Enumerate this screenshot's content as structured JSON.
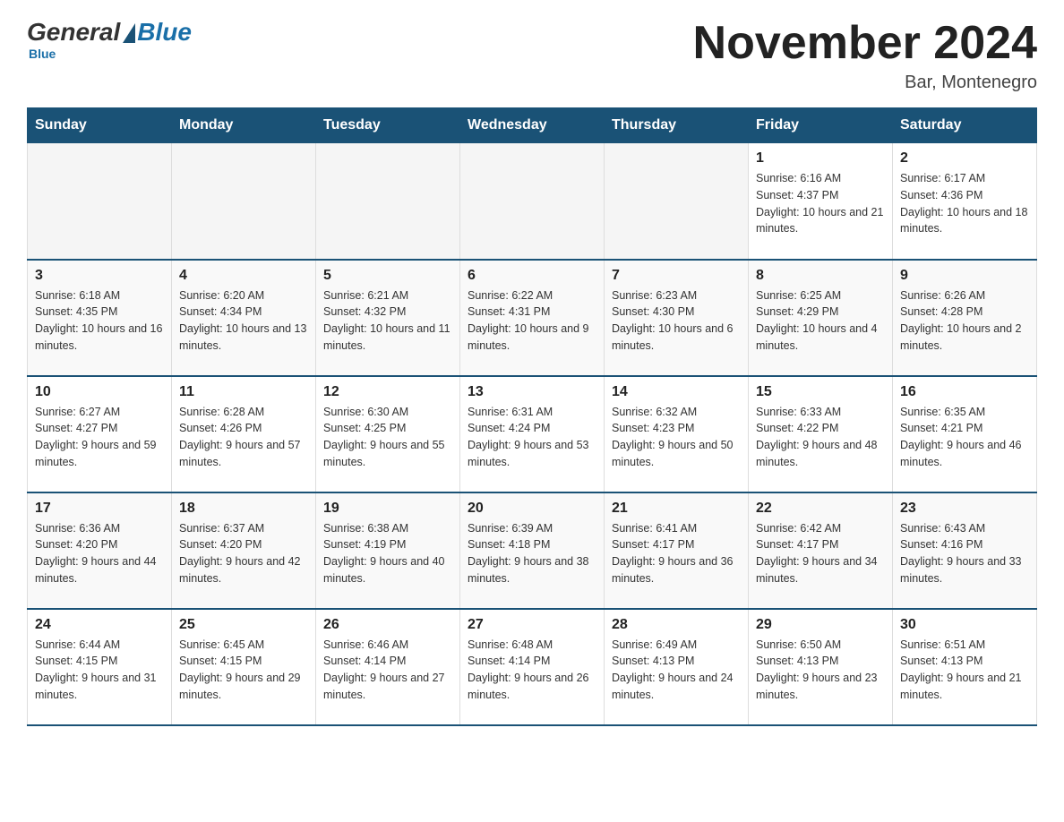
{
  "logo": {
    "general": "General",
    "blue": "Blue",
    "tagline": "Blue"
  },
  "title": "November 2024",
  "location": "Bar, Montenegro",
  "days_of_week": [
    "Sunday",
    "Monday",
    "Tuesday",
    "Wednesday",
    "Thursday",
    "Friday",
    "Saturday"
  ],
  "weeks": [
    [
      {
        "day": "",
        "sunrise": "",
        "sunset": "",
        "daylight": ""
      },
      {
        "day": "",
        "sunrise": "",
        "sunset": "",
        "daylight": ""
      },
      {
        "day": "",
        "sunrise": "",
        "sunset": "",
        "daylight": ""
      },
      {
        "day": "",
        "sunrise": "",
        "sunset": "",
        "daylight": ""
      },
      {
        "day": "",
        "sunrise": "",
        "sunset": "",
        "daylight": ""
      },
      {
        "day": "1",
        "sunrise": "Sunrise: 6:16 AM",
        "sunset": "Sunset: 4:37 PM",
        "daylight": "Daylight: 10 hours and 21 minutes."
      },
      {
        "day": "2",
        "sunrise": "Sunrise: 6:17 AM",
        "sunset": "Sunset: 4:36 PM",
        "daylight": "Daylight: 10 hours and 18 minutes."
      }
    ],
    [
      {
        "day": "3",
        "sunrise": "Sunrise: 6:18 AM",
        "sunset": "Sunset: 4:35 PM",
        "daylight": "Daylight: 10 hours and 16 minutes."
      },
      {
        "day": "4",
        "sunrise": "Sunrise: 6:20 AM",
        "sunset": "Sunset: 4:34 PM",
        "daylight": "Daylight: 10 hours and 13 minutes."
      },
      {
        "day": "5",
        "sunrise": "Sunrise: 6:21 AM",
        "sunset": "Sunset: 4:32 PM",
        "daylight": "Daylight: 10 hours and 11 minutes."
      },
      {
        "day": "6",
        "sunrise": "Sunrise: 6:22 AM",
        "sunset": "Sunset: 4:31 PM",
        "daylight": "Daylight: 10 hours and 9 minutes."
      },
      {
        "day": "7",
        "sunrise": "Sunrise: 6:23 AM",
        "sunset": "Sunset: 4:30 PM",
        "daylight": "Daylight: 10 hours and 6 minutes."
      },
      {
        "day": "8",
        "sunrise": "Sunrise: 6:25 AM",
        "sunset": "Sunset: 4:29 PM",
        "daylight": "Daylight: 10 hours and 4 minutes."
      },
      {
        "day": "9",
        "sunrise": "Sunrise: 6:26 AM",
        "sunset": "Sunset: 4:28 PM",
        "daylight": "Daylight: 10 hours and 2 minutes."
      }
    ],
    [
      {
        "day": "10",
        "sunrise": "Sunrise: 6:27 AM",
        "sunset": "Sunset: 4:27 PM",
        "daylight": "Daylight: 9 hours and 59 minutes."
      },
      {
        "day": "11",
        "sunrise": "Sunrise: 6:28 AM",
        "sunset": "Sunset: 4:26 PM",
        "daylight": "Daylight: 9 hours and 57 minutes."
      },
      {
        "day": "12",
        "sunrise": "Sunrise: 6:30 AM",
        "sunset": "Sunset: 4:25 PM",
        "daylight": "Daylight: 9 hours and 55 minutes."
      },
      {
        "day": "13",
        "sunrise": "Sunrise: 6:31 AM",
        "sunset": "Sunset: 4:24 PM",
        "daylight": "Daylight: 9 hours and 53 minutes."
      },
      {
        "day": "14",
        "sunrise": "Sunrise: 6:32 AM",
        "sunset": "Sunset: 4:23 PM",
        "daylight": "Daylight: 9 hours and 50 minutes."
      },
      {
        "day": "15",
        "sunrise": "Sunrise: 6:33 AM",
        "sunset": "Sunset: 4:22 PM",
        "daylight": "Daylight: 9 hours and 48 minutes."
      },
      {
        "day": "16",
        "sunrise": "Sunrise: 6:35 AM",
        "sunset": "Sunset: 4:21 PM",
        "daylight": "Daylight: 9 hours and 46 minutes."
      }
    ],
    [
      {
        "day": "17",
        "sunrise": "Sunrise: 6:36 AM",
        "sunset": "Sunset: 4:20 PM",
        "daylight": "Daylight: 9 hours and 44 minutes."
      },
      {
        "day": "18",
        "sunrise": "Sunrise: 6:37 AM",
        "sunset": "Sunset: 4:20 PM",
        "daylight": "Daylight: 9 hours and 42 minutes."
      },
      {
        "day": "19",
        "sunrise": "Sunrise: 6:38 AM",
        "sunset": "Sunset: 4:19 PM",
        "daylight": "Daylight: 9 hours and 40 minutes."
      },
      {
        "day": "20",
        "sunrise": "Sunrise: 6:39 AM",
        "sunset": "Sunset: 4:18 PM",
        "daylight": "Daylight: 9 hours and 38 minutes."
      },
      {
        "day": "21",
        "sunrise": "Sunrise: 6:41 AM",
        "sunset": "Sunset: 4:17 PM",
        "daylight": "Daylight: 9 hours and 36 minutes."
      },
      {
        "day": "22",
        "sunrise": "Sunrise: 6:42 AM",
        "sunset": "Sunset: 4:17 PM",
        "daylight": "Daylight: 9 hours and 34 minutes."
      },
      {
        "day": "23",
        "sunrise": "Sunrise: 6:43 AM",
        "sunset": "Sunset: 4:16 PM",
        "daylight": "Daylight: 9 hours and 33 minutes."
      }
    ],
    [
      {
        "day": "24",
        "sunrise": "Sunrise: 6:44 AM",
        "sunset": "Sunset: 4:15 PM",
        "daylight": "Daylight: 9 hours and 31 minutes."
      },
      {
        "day": "25",
        "sunrise": "Sunrise: 6:45 AM",
        "sunset": "Sunset: 4:15 PM",
        "daylight": "Daylight: 9 hours and 29 minutes."
      },
      {
        "day": "26",
        "sunrise": "Sunrise: 6:46 AM",
        "sunset": "Sunset: 4:14 PM",
        "daylight": "Daylight: 9 hours and 27 minutes."
      },
      {
        "day": "27",
        "sunrise": "Sunrise: 6:48 AM",
        "sunset": "Sunset: 4:14 PM",
        "daylight": "Daylight: 9 hours and 26 minutes."
      },
      {
        "day": "28",
        "sunrise": "Sunrise: 6:49 AM",
        "sunset": "Sunset: 4:13 PM",
        "daylight": "Daylight: 9 hours and 24 minutes."
      },
      {
        "day": "29",
        "sunrise": "Sunrise: 6:50 AM",
        "sunset": "Sunset: 4:13 PM",
        "daylight": "Daylight: 9 hours and 23 minutes."
      },
      {
        "day": "30",
        "sunrise": "Sunrise: 6:51 AM",
        "sunset": "Sunset: 4:13 PM",
        "daylight": "Daylight: 9 hours and 21 minutes."
      }
    ]
  ]
}
